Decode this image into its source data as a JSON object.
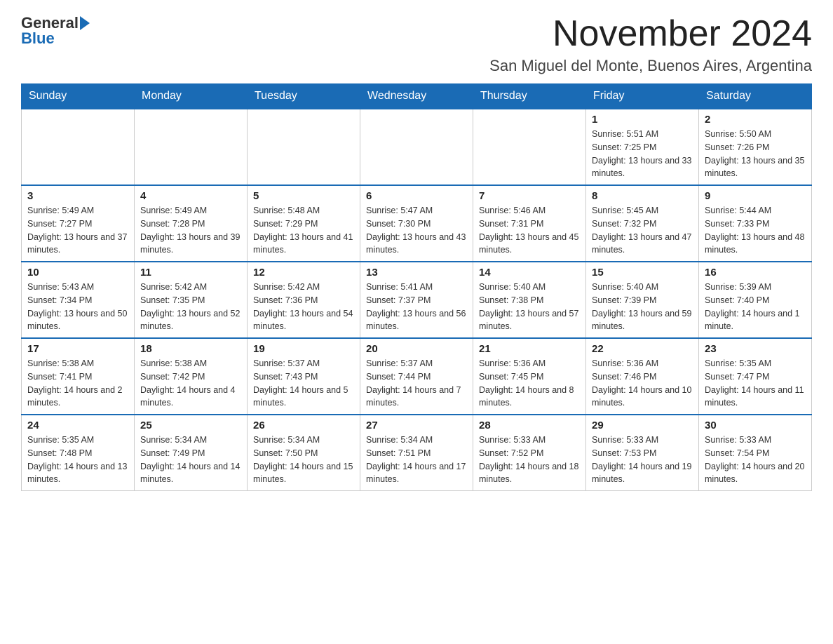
{
  "header": {
    "logo_general": "General",
    "logo_blue": "Blue",
    "title": "November 2024",
    "subtitle": "San Miguel del Monte, Buenos Aires, Argentina"
  },
  "days_of_week": [
    "Sunday",
    "Monday",
    "Tuesday",
    "Wednesday",
    "Thursday",
    "Friday",
    "Saturday"
  ],
  "weeks": [
    [
      {
        "day": "",
        "sunrise": "",
        "sunset": "",
        "daylight": ""
      },
      {
        "day": "",
        "sunrise": "",
        "sunset": "",
        "daylight": ""
      },
      {
        "day": "",
        "sunrise": "",
        "sunset": "",
        "daylight": ""
      },
      {
        "day": "",
        "sunrise": "",
        "sunset": "",
        "daylight": ""
      },
      {
        "day": "",
        "sunrise": "",
        "sunset": "",
        "daylight": ""
      },
      {
        "day": "1",
        "sunrise": "Sunrise: 5:51 AM",
        "sunset": "Sunset: 7:25 PM",
        "daylight": "Daylight: 13 hours and 33 minutes."
      },
      {
        "day": "2",
        "sunrise": "Sunrise: 5:50 AM",
        "sunset": "Sunset: 7:26 PM",
        "daylight": "Daylight: 13 hours and 35 minutes."
      }
    ],
    [
      {
        "day": "3",
        "sunrise": "Sunrise: 5:49 AM",
        "sunset": "Sunset: 7:27 PM",
        "daylight": "Daylight: 13 hours and 37 minutes."
      },
      {
        "day": "4",
        "sunrise": "Sunrise: 5:49 AM",
        "sunset": "Sunset: 7:28 PM",
        "daylight": "Daylight: 13 hours and 39 minutes."
      },
      {
        "day": "5",
        "sunrise": "Sunrise: 5:48 AM",
        "sunset": "Sunset: 7:29 PM",
        "daylight": "Daylight: 13 hours and 41 minutes."
      },
      {
        "day": "6",
        "sunrise": "Sunrise: 5:47 AM",
        "sunset": "Sunset: 7:30 PM",
        "daylight": "Daylight: 13 hours and 43 minutes."
      },
      {
        "day": "7",
        "sunrise": "Sunrise: 5:46 AM",
        "sunset": "Sunset: 7:31 PM",
        "daylight": "Daylight: 13 hours and 45 minutes."
      },
      {
        "day": "8",
        "sunrise": "Sunrise: 5:45 AM",
        "sunset": "Sunset: 7:32 PM",
        "daylight": "Daylight: 13 hours and 47 minutes."
      },
      {
        "day": "9",
        "sunrise": "Sunrise: 5:44 AM",
        "sunset": "Sunset: 7:33 PM",
        "daylight": "Daylight: 13 hours and 48 minutes."
      }
    ],
    [
      {
        "day": "10",
        "sunrise": "Sunrise: 5:43 AM",
        "sunset": "Sunset: 7:34 PM",
        "daylight": "Daylight: 13 hours and 50 minutes."
      },
      {
        "day": "11",
        "sunrise": "Sunrise: 5:42 AM",
        "sunset": "Sunset: 7:35 PM",
        "daylight": "Daylight: 13 hours and 52 minutes."
      },
      {
        "day": "12",
        "sunrise": "Sunrise: 5:42 AM",
        "sunset": "Sunset: 7:36 PM",
        "daylight": "Daylight: 13 hours and 54 minutes."
      },
      {
        "day": "13",
        "sunrise": "Sunrise: 5:41 AM",
        "sunset": "Sunset: 7:37 PM",
        "daylight": "Daylight: 13 hours and 56 minutes."
      },
      {
        "day": "14",
        "sunrise": "Sunrise: 5:40 AM",
        "sunset": "Sunset: 7:38 PM",
        "daylight": "Daylight: 13 hours and 57 minutes."
      },
      {
        "day": "15",
        "sunrise": "Sunrise: 5:40 AM",
        "sunset": "Sunset: 7:39 PM",
        "daylight": "Daylight: 13 hours and 59 minutes."
      },
      {
        "day": "16",
        "sunrise": "Sunrise: 5:39 AM",
        "sunset": "Sunset: 7:40 PM",
        "daylight": "Daylight: 14 hours and 1 minute."
      }
    ],
    [
      {
        "day": "17",
        "sunrise": "Sunrise: 5:38 AM",
        "sunset": "Sunset: 7:41 PM",
        "daylight": "Daylight: 14 hours and 2 minutes."
      },
      {
        "day": "18",
        "sunrise": "Sunrise: 5:38 AM",
        "sunset": "Sunset: 7:42 PM",
        "daylight": "Daylight: 14 hours and 4 minutes."
      },
      {
        "day": "19",
        "sunrise": "Sunrise: 5:37 AM",
        "sunset": "Sunset: 7:43 PM",
        "daylight": "Daylight: 14 hours and 5 minutes."
      },
      {
        "day": "20",
        "sunrise": "Sunrise: 5:37 AM",
        "sunset": "Sunset: 7:44 PM",
        "daylight": "Daylight: 14 hours and 7 minutes."
      },
      {
        "day": "21",
        "sunrise": "Sunrise: 5:36 AM",
        "sunset": "Sunset: 7:45 PM",
        "daylight": "Daylight: 14 hours and 8 minutes."
      },
      {
        "day": "22",
        "sunrise": "Sunrise: 5:36 AM",
        "sunset": "Sunset: 7:46 PM",
        "daylight": "Daylight: 14 hours and 10 minutes."
      },
      {
        "day": "23",
        "sunrise": "Sunrise: 5:35 AM",
        "sunset": "Sunset: 7:47 PM",
        "daylight": "Daylight: 14 hours and 11 minutes."
      }
    ],
    [
      {
        "day": "24",
        "sunrise": "Sunrise: 5:35 AM",
        "sunset": "Sunset: 7:48 PM",
        "daylight": "Daylight: 14 hours and 13 minutes."
      },
      {
        "day": "25",
        "sunrise": "Sunrise: 5:34 AM",
        "sunset": "Sunset: 7:49 PM",
        "daylight": "Daylight: 14 hours and 14 minutes."
      },
      {
        "day": "26",
        "sunrise": "Sunrise: 5:34 AM",
        "sunset": "Sunset: 7:50 PM",
        "daylight": "Daylight: 14 hours and 15 minutes."
      },
      {
        "day": "27",
        "sunrise": "Sunrise: 5:34 AM",
        "sunset": "Sunset: 7:51 PM",
        "daylight": "Daylight: 14 hours and 17 minutes."
      },
      {
        "day": "28",
        "sunrise": "Sunrise: 5:33 AM",
        "sunset": "Sunset: 7:52 PM",
        "daylight": "Daylight: 14 hours and 18 minutes."
      },
      {
        "day": "29",
        "sunrise": "Sunrise: 5:33 AM",
        "sunset": "Sunset: 7:53 PM",
        "daylight": "Daylight: 14 hours and 19 minutes."
      },
      {
        "day": "30",
        "sunrise": "Sunrise: 5:33 AM",
        "sunset": "Sunset: 7:54 PM",
        "daylight": "Daylight: 14 hours and 20 minutes."
      }
    ]
  ]
}
